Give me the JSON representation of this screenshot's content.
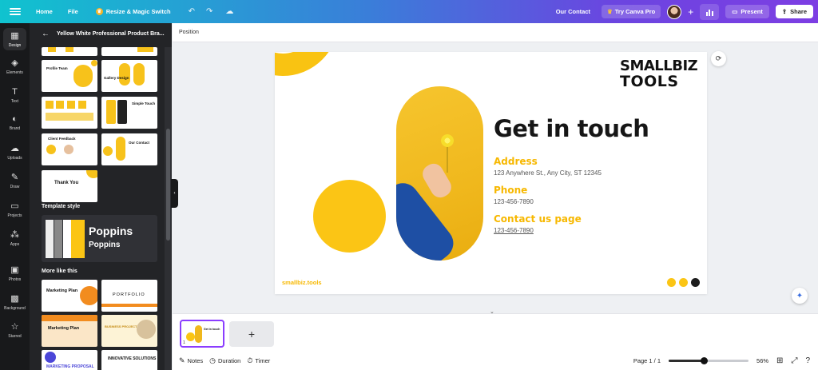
{
  "topbar": {
    "home": "Home",
    "file": "File",
    "resize": "Resize & Magic Switch",
    "our_contact": "Our Contact",
    "try_canva_pro": "Try Canva Pro",
    "present": "Present",
    "share": "Share"
  },
  "rail": {
    "items": [
      {
        "label": "Design",
        "icon": "design-icon"
      },
      {
        "label": "Elements",
        "icon": "elements-icon"
      },
      {
        "label": "Text",
        "icon": "text-icon"
      },
      {
        "label": "Brand",
        "icon": "brand-icon"
      },
      {
        "label": "Uploads",
        "icon": "uploads-icon"
      },
      {
        "label": "Draw",
        "icon": "draw-icon"
      },
      {
        "label": "Projects",
        "icon": "projects-icon"
      },
      {
        "label": "Apps",
        "icon": "apps-icon"
      },
      {
        "label": "Photos",
        "icon": "photos-icon"
      },
      {
        "label": "Background",
        "icon": "background-icon"
      },
      {
        "label": "Starred",
        "icon": "starred-icon"
      }
    ]
  },
  "panel": {
    "title": "Yellow White Professional Product Bra...",
    "thumbs": {
      "profile": "Profile Team",
      "gallery": "Gallery Design",
      "simple": "Simple Touch",
      "client": "Client Feedback",
      "contact": "Our Contact",
      "thank_you": "Thank You"
    },
    "template_style": "Template style",
    "font_heading": "Poppins",
    "font_body": "Poppins",
    "more_like_this": "More like this",
    "more": {
      "m1": "Marketing Plan",
      "m2": "PORTFOLIO",
      "m3": "Marketing Plan",
      "m4": "BUSINESS PROJECT",
      "m5": "MARKETING PROPOSAL",
      "m6": "INNOVATIVE SOLUTIONS"
    }
  },
  "editor": {
    "position": "Position"
  },
  "slide": {
    "logo_line1": "SMALLBIZ",
    "logo_line2": "TOOLS",
    "title": "Get in touch",
    "address_label": "Address",
    "address_value": "123 Anywhere St., Any City, ST 12345",
    "phone_label": "Phone",
    "phone_value": "123-456-7890",
    "contact_label": "Contact us page",
    "contact_value": "123-456-7890",
    "footer": "smallbiz.tools",
    "colors": {
      "yellow": "#fbc515",
      "dark": "#1d1d1d"
    }
  },
  "pages": {
    "page_number": "1",
    "add_label": "+"
  },
  "bottombar": {
    "notes": "Notes",
    "duration": "Duration",
    "timer": "Timer",
    "page_indicator": "Page 1 / 1",
    "zoom": "56%",
    "zoom_level": 0.44
  }
}
